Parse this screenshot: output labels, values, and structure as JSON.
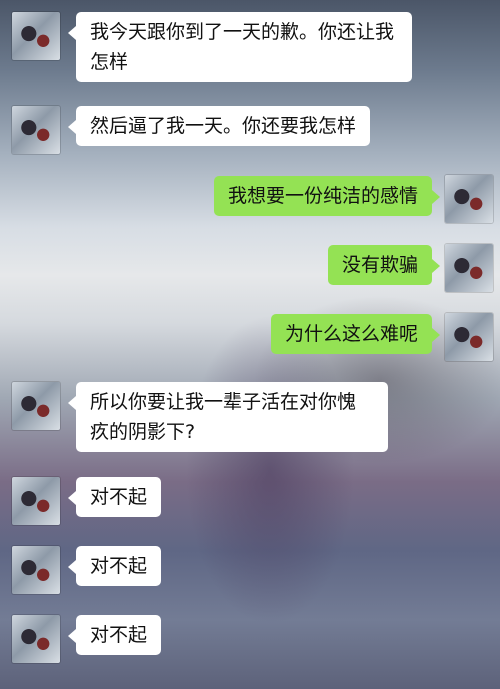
{
  "colors": {
    "incoming_bubble": "#ffffff",
    "outgoing_bubble": "#94e254",
    "text": "#111111"
  },
  "messages": [
    {
      "from": "other",
      "text": "我今天跟你到了一天的歉。你还让我怎样"
    },
    {
      "from": "other",
      "text": "然后逼了我一天。你还要我怎样"
    },
    {
      "from": "me",
      "text": "我想要一份纯洁的感情"
    },
    {
      "from": "me",
      "text": "没有欺骗"
    },
    {
      "from": "me",
      "text": "为什么这么难呢"
    },
    {
      "from": "other",
      "text": "所以你要让我一辈子活在对你愧疚的阴影下?"
    },
    {
      "from": "other",
      "text": "对不起"
    },
    {
      "from": "other",
      "text": "对不起"
    },
    {
      "from": "other",
      "text": "对不起"
    }
  ]
}
